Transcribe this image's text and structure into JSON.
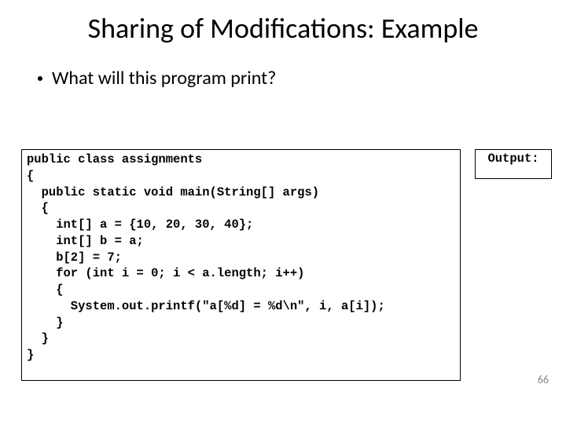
{
  "title": "Sharing of Modifications: Example",
  "bullet": "What will this program print?",
  "code": "public class assignments\n{\n  public static void main(String[] args)\n  {\n    int[] a = {10, 20, 30, 40};\n    int[] b = a;\n    b[2] = 7;\n    for (int i = 0; i < a.length; i++)\n    {\n      System.out.printf(\"a[%d] = %d\\n\", i, a[i]);\n    }\n  }\n}",
  "output_label": "Output:",
  "page_number": "66"
}
